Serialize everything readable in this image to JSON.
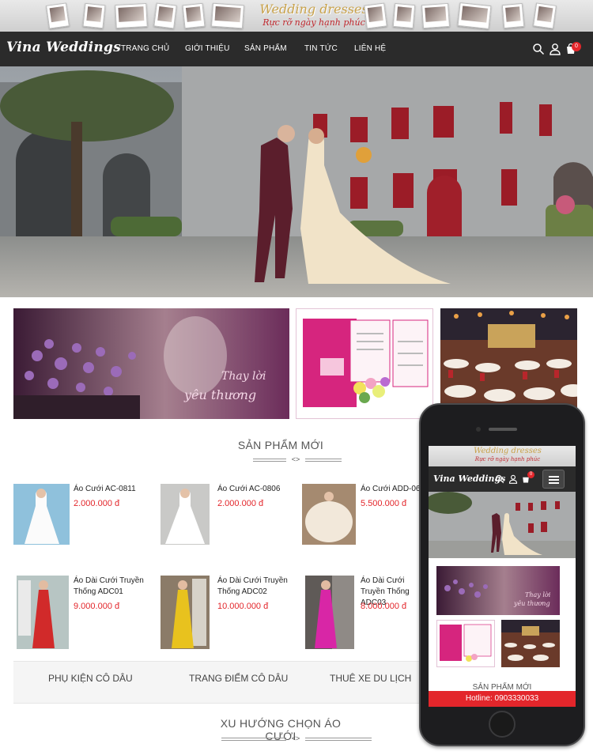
{
  "brand": {
    "logo": "Vina Weddings",
    "strip_title": "Wedding dresses",
    "strip_subtitle": "Rực rỡ ngày hạnh phúc"
  },
  "nav": {
    "items": [
      "TRANG CHỦ",
      "GIỚI THIỆU",
      "SẢN PHẨM",
      "TIN TỨC",
      "LIÊN HỆ"
    ],
    "cart_count": "0"
  },
  "promo": {
    "banner1_text_line1": "Thay lời",
    "banner1_text_line2": "yêu thương"
  },
  "new_products": {
    "title": "SẢN PHẨM MỚI",
    "arrows": "<>",
    "items": [
      {
        "name": "Áo Cưới AC-0811",
        "price": "2.000.000 đ"
      },
      {
        "name": "Áo Cưới AC-0806",
        "price": "2.000.000 đ"
      },
      {
        "name": "Áo Cưới ADD-067",
        "price": "5.500.000 đ"
      },
      {
        "name": "Áo Dài Cưới Truyền Thống ADC01",
        "price": "9.000.000 đ"
      },
      {
        "name": "Áo Dài Cưới Truyền Thống ADC02",
        "price": "10.000.000 đ"
      },
      {
        "name": "Áo Dài Cưới Truyền Thống ADC03",
        "price": "8.000.000 đ"
      }
    ]
  },
  "categories": [
    "PHỤ KIỆN CÔ DÂU",
    "TRANG ĐIỂM CÔ DÂU",
    "THUÊ XE DU LỊCH"
  ],
  "trends": {
    "title": "XU HƯỚNG CHỌN ÁO CƯỚI",
    "arrows": "<>"
  },
  "mobile": {
    "logo": "Vina Weddings",
    "strip_title": "Wedding dresses",
    "strip_subtitle": "Rực rỡ ngày hạnh phúc",
    "cart_count": "0",
    "section_title": "SẢN PHẨM MỚI",
    "hotline": "Hotline: 0903330033"
  },
  "colors": {
    "nav_bg": "#2b2b2b",
    "accent_red": "#e3262b",
    "pink": "#d6257e"
  },
  "icons": [
    "search-icon",
    "user-icon",
    "cart-icon",
    "hamburger-menu-icon"
  ]
}
